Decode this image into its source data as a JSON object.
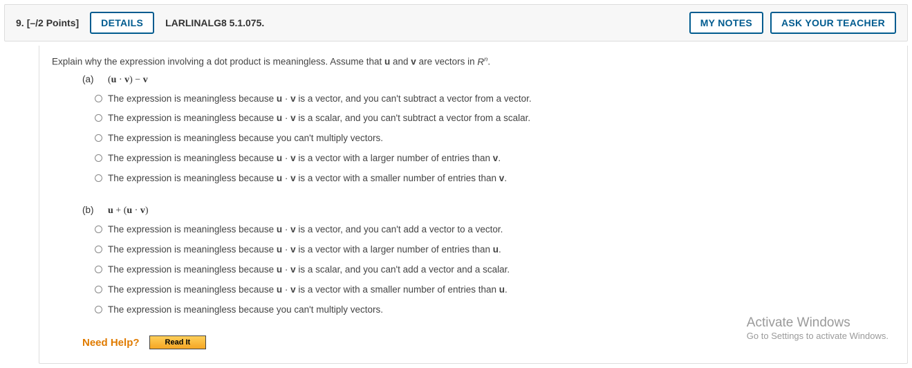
{
  "header": {
    "qnumber": "9.",
    "points": "[–/2 Points]",
    "details_btn": "DETAILS",
    "bookref": "LARLINALG8 5.1.075.",
    "mynotes_btn": "MY NOTES",
    "askteacher_btn": "ASK YOUR TEACHER"
  },
  "prompt": {
    "pre": "Explain why the expression involving a dot product is meaningless. Assume that ",
    "u": "u",
    "mid": " and ",
    "v": "v",
    "post1": " are vectors in  ",
    "space_base": "R",
    "space_sup": "n",
    "post2": "."
  },
  "parts": [
    {
      "label": "(a)",
      "expr_html": "(<b>u</b> · <b>v</b>) − <b>v</b>",
      "options": [
        {
          "pre": "The expression is meaningless because ",
          "mid": " is a vector, and you can't subtract a vector from a vector.",
          "uv": true
        },
        {
          "pre": "The expression is meaningless because ",
          "mid": " is a scalar, and you can't subtract a vector from a scalar.",
          "uv": true
        },
        {
          "pre": "The expression is meaningless because you can't multiply vectors.",
          "mid": "",
          "uv": false
        },
        {
          "pre": "The expression is meaningless because ",
          "mid": " is a vector with a larger number of entries than ",
          "tail": ".",
          "uv": true,
          "tailvec": "v"
        },
        {
          "pre": "The expression is meaningless because ",
          "mid": " is a vector with a smaller number of entries than ",
          "tail": ".",
          "uv": true,
          "tailvec": "v"
        }
      ]
    },
    {
      "label": "(b)",
      "expr_html": "<b>u</b> + (<b>u</b> · <b>v</b>)",
      "options": [
        {
          "pre": "The expression is meaningless because ",
          "mid": " is a vector, and you can't add a vector to a vector.",
          "uv": true
        },
        {
          "pre": "The expression is meaningless because ",
          "mid": " is a vector with a larger number of entries than ",
          "tail": ".",
          "uv": true,
          "tailvec": "u"
        },
        {
          "pre": "The expression is meaningless because ",
          "mid": " is a scalar, and you can't add a vector and a scalar.",
          "uv": true
        },
        {
          "pre": "The expression is meaningless because ",
          "mid": " is a vector with a smaller number of entries than ",
          "tail": ".",
          "uv": true,
          "tailvec": "u"
        },
        {
          "pre": "The expression is meaningless because you can't multiply vectors.",
          "mid": "",
          "uv": false
        }
      ]
    }
  ],
  "need_help": {
    "label": "Need Help?",
    "readit": "Read It"
  },
  "watermark": {
    "l1": "Activate Windows",
    "l2": "Go to Settings to activate Windows."
  }
}
